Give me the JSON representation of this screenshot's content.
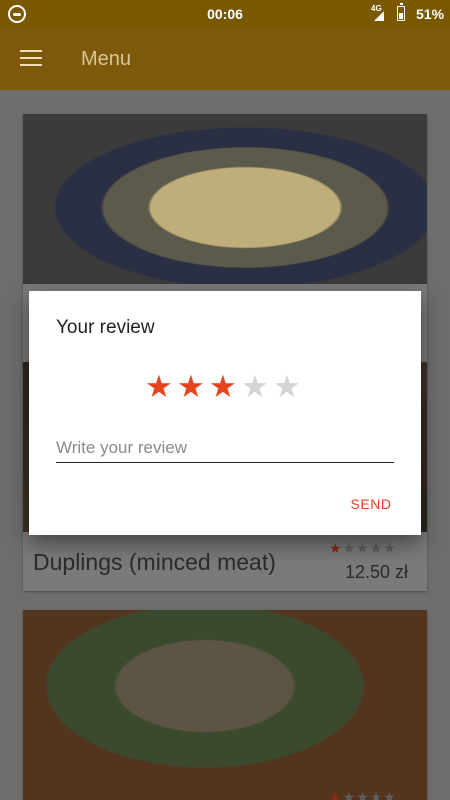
{
  "status_bar": {
    "time": "00:06",
    "network": "4G",
    "battery": "51%"
  },
  "app_bar": {
    "title": "Menu",
    "menu_icon": "hamburger-icon"
  },
  "dishes": [
    {
      "name": "Duplings (minced meat)",
      "price": "12.50 zł",
      "rating": 1,
      "max_rating": 5
    },
    {
      "rating": 1,
      "max_rating": 5
    }
  ],
  "review_dialog": {
    "title": "Your review",
    "rating": 3,
    "max_rating": 5,
    "review_placeholder": "Write your review",
    "review_value": "",
    "send_label": "SEND",
    "accent_color": "#e5441d"
  }
}
